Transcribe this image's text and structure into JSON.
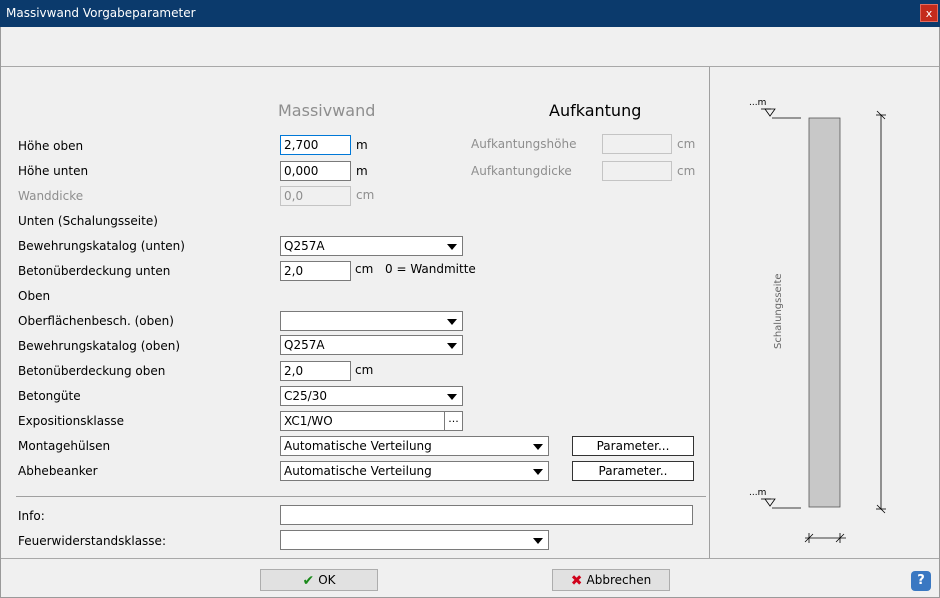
{
  "window": {
    "title": "Massivwand Vorgabeparameter",
    "close": "x"
  },
  "sections": {
    "massivwand": "Massivwand",
    "aufkantung": "Aufkantung"
  },
  "form": {
    "hoehe_oben": {
      "label": "Höhe oben",
      "value": "2,700",
      "unit": "m"
    },
    "hoehe_unten": {
      "label": "Höhe unten",
      "value": "0,000",
      "unit": "m"
    },
    "wanddicke": {
      "label": "Wanddicke",
      "value": "0,0",
      "unit": "cm"
    },
    "unten_header": "Unten (Schalungsseite)",
    "bewehrung_unten": {
      "label": "Bewehrungskatalog (unten)",
      "value": "Q257A"
    },
    "betonueberdeckung_unten": {
      "label": "Betonüberdeckung unten",
      "value": "2,0",
      "unit": "cm",
      "note": "0 = Wandmitte"
    },
    "oben_header": "Oben",
    "oberflaeche_oben": {
      "label": "Oberflächenbesch. (oben)",
      "value": ""
    },
    "bewehrung_oben": {
      "label": "Bewehrungskatalog (oben)",
      "value": "Q257A"
    },
    "betonueberdeckung_oben": {
      "label": "Betonüberdeckung oben",
      "value": "2,0",
      "unit": "cm"
    },
    "betonguete": {
      "label": "Betongüte",
      "value": "C25/30"
    },
    "expositionsklasse": {
      "label": "Expositionsklasse",
      "value": "XC1/WO",
      "button": "..."
    },
    "montagehuelsen": {
      "label": "Montagehülsen",
      "value": "Automatische Verteilung",
      "button": "Parameter..."
    },
    "abhebeanker": {
      "label": "Abhebeanker",
      "value": "Automatische Verteilung",
      "button": "Parameter.."
    },
    "info": {
      "label": "Info:",
      "value": ""
    },
    "feuerwiderstand": {
      "label": "Feuerwiderstandsklasse:",
      "value": ""
    }
  },
  "aufkantung": {
    "hoehe": {
      "label": "Aufkantungshöhe",
      "value": "",
      "unit": "cm"
    },
    "dicke": {
      "label": "Aufkantungdicke",
      "value": "",
      "unit": "cm"
    }
  },
  "preview": {
    "top_marker": "...m",
    "bottom_marker": "...m",
    "side_label": "Schalungsseite"
  },
  "buttons": {
    "ok": "OK",
    "cancel": "Abbrechen",
    "help": "?"
  },
  "colors": {
    "titlebar": "#0b3a6c",
    "close": "#c42b1c",
    "ok_check": "#1a8a1a",
    "cancel_x": "#d0021b",
    "wall_fill": "#c8c8c8"
  }
}
